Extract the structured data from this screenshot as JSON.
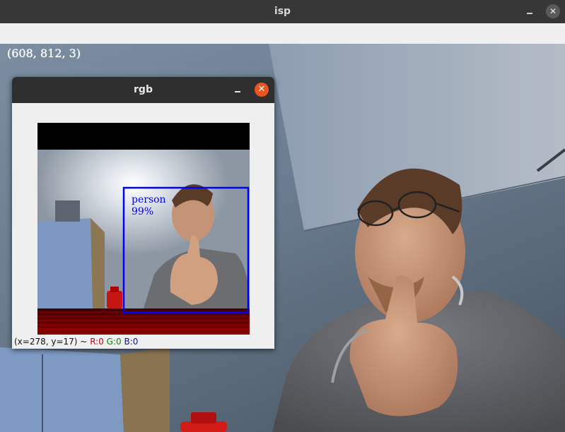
{
  "window": {
    "title": "isp",
    "minimize_icon": "minimize-icon",
    "close_icon": "close-icon",
    "close_glyph": "✕"
  },
  "overlay": {
    "shape_text": "(608, 812, 3)"
  },
  "rgb_window": {
    "title": "rgb",
    "close_glyph": "✕",
    "close_color": "#e95420",
    "detection": {
      "label": "person",
      "confidence": "99%",
      "box_color": "#0000ff"
    },
    "status": {
      "position": "(x=278, y=17) ~",
      "r": "R:0",
      "g": "G:0",
      "b": "B:0"
    }
  }
}
